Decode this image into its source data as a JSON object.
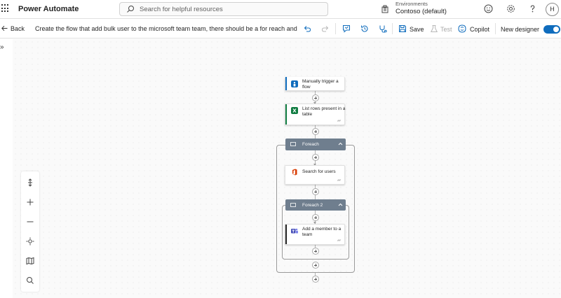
{
  "header": {
    "app_name": "Power Automate",
    "search_placeholder": "Search for helpful resources",
    "env_label": "Environments",
    "env_name": "Contoso (default)",
    "avatar_initial": "H"
  },
  "commandbar": {
    "back_label": "Back",
    "flow_title": "Create the flow that add bulk user to the microsoft team team, there should be a for reach and",
    "save_label": "Save",
    "test_label": "Test",
    "copilot_label": "Copilot",
    "new_designer_label": "New designer",
    "new_designer_on": true
  },
  "flow": {
    "trigger": {
      "title": "Manually trigger a flow",
      "icon": "manual-trigger-icon",
      "color": "#0f6cbd"
    },
    "list_rows": {
      "title": "List rows present in a table",
      "icon": "excel-icon",
      "color": "#107c41"
    },
    "foreach1": {
      "title": "Foreach",
      "color": "#6f7e8e"
    },
    "search_users": {
      "title": "Search for users",
      "icon": "office365-icon",
      "color": "#d83b01"
    },
    "foreach2": {
      "title": "Foreach 2",
      "color": "#6f7e8e"
    },
    "add_member": {
      "title": "Add a member to a team",
      "icon": "teams-icon",
      "color": "#464eb8"
    }
  }
}
